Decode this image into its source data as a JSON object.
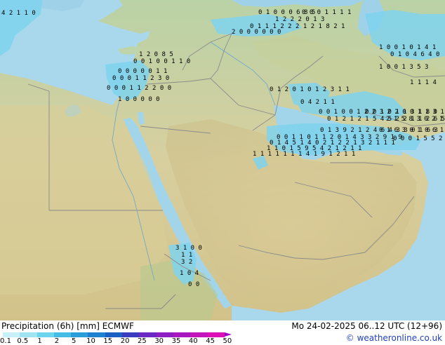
{
  "map": {
    "precip_label_rows": [
      {
        "text": "4 2 1 1 0",
        "area": "cyprus-west"
      },
      {
        "text": "0 1 0 0 0 6 8 5",
        "area": "northwest-iran-1"
      },
      {
        "text": "0 0 0 1 1 1 1",
        "area": "northwest-iran-2"
      },
      {
        "text": "1 2 2 2 0 1 3",
        "area": "northwest-iran-3"
      },
      {
        "text": "0 1 1 1 2 2 2 1 2 1 8 2 1",
        "area": "northwest-iran-4"
      },
      {
        "text": "2 0 0 0 0 0 0",
        "area": "northwest-iran-5"
      },
      {
        "text": "1 2 0 8 5",
        "area": "levant-coast-1"
      },
      {
        "text": "0 0 1 0 0 1 1 0",
        "area": "levant-coast-2"
      },
      {
        "text": "0 0 0 0 0 1 1",
        "area": "levant-coast-3"
      },
      {
        "text": "0 0 0 1 1 2 3 0",
        "area": "levant-coast-4"
      },
      {
        "text": "0 0 0 1 1 2 2 0 0",
        "area": "levant-coast-5"
      },
      {
        "text": "1 0 0 0 0 0",
        "area": "levant-coast-6"
      },
      {
        "text": "0 1 2 0 1 0 1 2 3 1 1",
        "area": "southern-iraq"
      },
      {
        "text": "0 4 2 1 1",
        "area": "gulf-north-1"
      },
      {
        "text": "0 0 1 0 0 1 2 2 3 2 2 0 0 1 1 3 1",
        "area": "gulf-north-2"
      },
      {
        "text": "0 1 2 1 2 1 5 4 5 2 2 1 1 2 6 5 3 0 2 1",
        "area": "gulf-2"
      },
      {
        "text": "0 1 3 9 2 1 2 4 6 4 3 3 0 1 6 3",
        "area": "gulf-3"
      },
      {
        "text": "0 0 1 1 0 1 1 2 0 1 4 3 3 2 9 1 9",
        "area": "gulf-4"
      },
      {
        "text": "0 1 4 5 1 4 0 2 1 2 2 1 3 2 1 1 1",
        "area": "gulf-5"
      },
      {
        "text": "1 1 0 1 5 9 5 4 2 1 2 1 1",
        "area": "gulf-6"
      },
      {
        "text": "1 1 1 1 1 1 1 4 1 9 1 2 1 1",
        "area": "gulf-7"
      },
      {
        "text": "3 1 0 0",
        "area": "red-sea-south-1"
      },
      {
        "text": "1 1",
        "area": "red-sea-south-2"
      },
      {
        "text": "3 2",
        "area": "red-sea-south-3"
      },
      {
        "text": "1 0 4",
        "area": "red-sea-south-4"
      },
      {
        "text": "0 0",
        "area": "red-sea-south-5"
      },
      {
        "text": "1 0 0 1 0 1 4 1",
        "area": "northeast-1"
      },
      {
        "text": "0 1 0 4 6 4 0",
        "area": "northeast-2"
      },
      {
        "text": "1 0 0 1 3 5 3",
        "area": "northeast-3"
      },
      {
        "text": "1 1 1 4",
        "area": "northeast-4"
      },
      {
        "text": "0 0 1 0 1 1 3 1 8 0",
        "area": "east-1"
      },
      {
        "text": "2 1 5 8 3 0 2 1",
        "area": "east-2"
      },
      {
        "text": "0 1 6 3 0 1 0 6 1 1",
        "area": "east-3"
      },
      {
        "text": "0 0 0 1 5 5 2 9 0",
        "area": "east-4"
      }
    ]
  },
  "footer": {
    "title": "Precipitation (6h) [mm] ECMWF",
    "datetime": "Mo 24-02-2025 06..12 UTC (12+96)",
    "credit": "© weatheronline.co.uk",
    "scale_labels": [
      "0.1",
      "0.5",
      "1",
      "2",
      "5",
      "10",
      "15",
      "20",
      "25",
      "30",
      "35",
      "40",
      "45",
      "50"
    ],
    "scale_colors": [
      "#c8f0f8",
      "#a0e4f4",
      "#6cd4ec",
      "#44bce4",
      "#2a9ed8",
      "#1e80d0",
      "#1a60c4",
      "#3a3cc0",
      "#6a28c4",
      "#8c1ec4",
      "#a818c0",
      "#c414bc",
      "#dc10b4",
      "#a000c8"
    ]
  }
}
